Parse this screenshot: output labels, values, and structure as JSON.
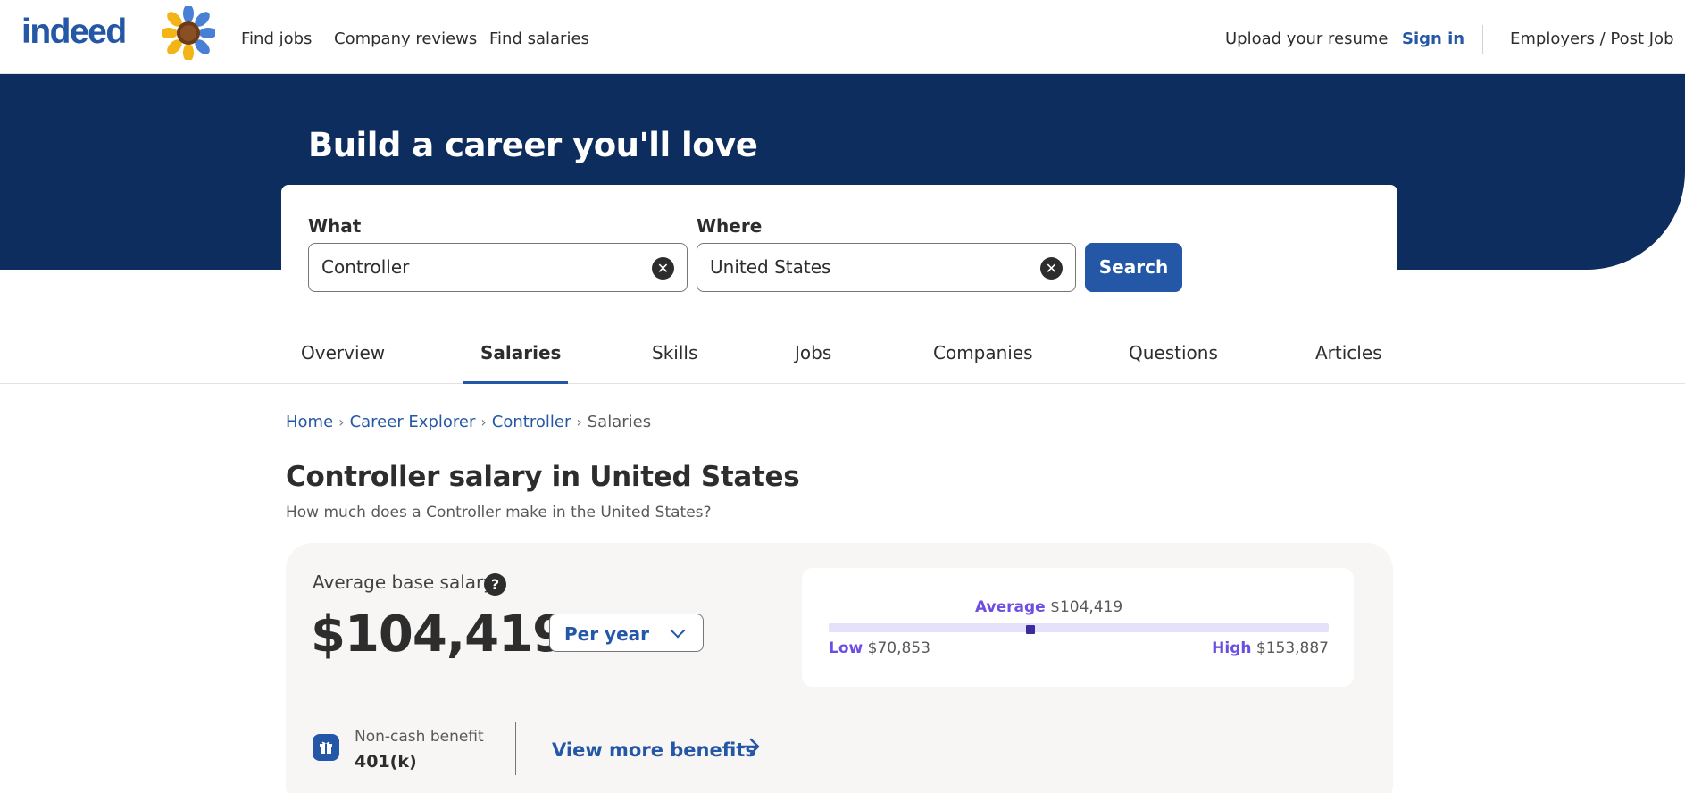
{
  "header": {
    "logo": "indeed",
    "nav": [
      "Find jobs",
      "Company reviews",
      "Find salaries"
    ],
    "upload_resume": "Upload your resume",
    "sign_in": "Sign in",
    "employers": "Employers / Post Job"
  },
  "hero": {
    "title": "Build a career you'll love"
  },
  "search": {
    "what_label": "What",
    "what_value": "Controller",
    "where_label": "Where",
    "where_value": "United States",
    "button": "Search"
  },
  "tabs": [
    "Overview",
    "Salaries",
    "Skills",
    "Jobs",
    "Companies",
    "Questions",
    "Articles"
  ],
  "active_tab": "Salaries",
  "breadcrumb": [
    "Home",
    "Career Explorer",
    "Controller",
    "Salaries"
  ],
  "page": {
    "title": "Controller salary in United States",
    "subtitle": "How much does a Controller make in the United States?"
  },
  "salary": {
    "avg_label": "Average base salary",
    "help": "?",
    "amount": "$104,419",
    "period": "Per year",
    "range": {
      "average_label": "Average",
      "average_value": "$104,419",
      "low_label": "Low",
      "low_value": "$70,853",
      "high_label": "High",
      "high_value": "$153,887",
      "low": 70853,
      "high": 153887,
      "average": 104419
    },
    "benefit_label": "Non-cash benefit",
    "benefit_value": "401(k)",
    "more_benefits": "View more benefits"
  },
  "colors": {
    "brand": "#2557a7",
    "hero_bg": "#0d2d5e",
    "accent": "#6c4ee3",
    "range_track": "#e5e1fa",
    "range_marker": "#3a2c9e"
  },
  "icons": {
    "clear": "clear-circle-icon",
    "help": "question-circle-icon",
    "dropdown": "chevron-down-icon",
    "benefit": "gift-icon",
    "more": "arrow-right-icon",
    "mascot": "sunflower-icon"
  }
}
